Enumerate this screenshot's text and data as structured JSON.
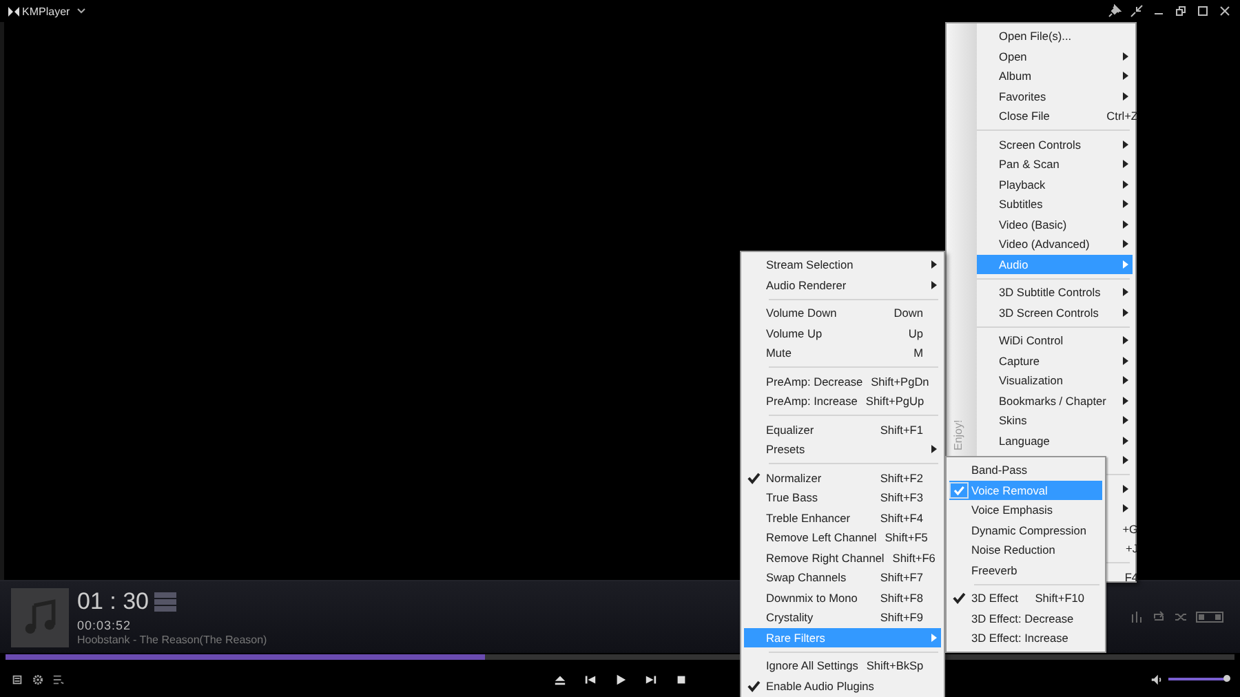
{
  "window": {
    "title": "KMPlayer"
  },
  "player": {
    "time": "01 : 30",
    "duration": "00:03:52",
    "track": "Hoobstank - The Reason(The Reason)",
    "progress": {
      "level": 0.39
    },
    "volume": {
      "level": 0.97
    }
  },
  "main_menu": {
    "side_text": "Enjoy!",
    "items": [
      {
        "kind": "item",
        "label": "Open File(s)...",
        "submenu": false,
        "selected": false
      },
      {
        "kind": "item",
        "label": "Open",
        "submenu": true,
        "selected": false
      },
      {
        "kind": "item",
        "label": "Album",
        "submenu": true,
        "selected": false
      },
      {
        "kind": "item",
        "label": "Favorites",
        "submenu": true,
        "selected": false
      },
      {
        "kind": "item",
        "label": "Close File",
        "shortcut": "Ctrl+Z",
        "submenu": false,
        "selected": false
      },
      {
        "kind": "separator"
      },
      {
        "kind": "item",
        "label": "Screen Controls",
        "submenu": true,
        "selected": false
      },
      {
        "kind": "item",
        "label": "Pan & Scan",
        "submenu": true,
        "selected": false
      },
      {
        "kind": "item",
        "label": "Playback",
        "submenu": true,
        "selected": false
      },
      {
        "kind": "item",
        "label": "Subtitles",
        "submenu": true,
        "selected": false
      },
      {
        "kind": "item",
        "label": "Video (Basic)",
        "submenu": true,
        "selected": false
      },
      {
        "kind": "item",
        "label": "Video (Advanced)",
        "submenu": true,
        "selected": false
      },
      {
        "kind": "item",
        "label": "Audio",
        "submenu": true,
        "selected": true
      },
      {
        "kind": "separator"
      },
      {
        "kind": "item",
        "label": "3D Subtitle Controls",
        "submenu": true,
        "selected": false
      },
      {
        "kind": "item",
        "label": "3D Screen Controls",
        "submenu": true,
        "selected": false
      },
      {
        "kind": "separator"
      },
      {
        "kind": "item",
        "label": "WiDi Control",
        "submenu": true,
        "selected": false
      },
      {
        "kind": "item",
        "label": "Capture",
        "submenu": true,
        "selected": false
      },
      {
        "kind": "item",
        "label": "Visualization",
        "submenu": true,
        "selected": false
      },
      {
        "kind": "item",
        "label": "Bookmarks / Chapter",
        "submenu": true,
        "selected": false
      },
      {
        "kind": "item",
        "label": "Skins",
        "submenu": true,
        "selected": false
      },
      {
        "kind": "item",
        "label": "Language",
        "submenu": true,
        "selected": false
      },
      {
        "kind": "item",
        "submenu": true,
        "selected": false
      },
      {
        "kind": "separator"
      },
      {
        "kind": "item",
        "submenu": true,
        "selected": false
      },
      {
        "kind": "item",
        "submenu": true,
        "selected": false
      },
      {
        "kind": "item",
        "shortcut": "+G",
        "submenu": false,
        "selected": false
      },
      {
        "kind": "item",
        "shortcut": "+J",
        "submenu": false,
        "selected": false
      },
      {
        "kind": "separator"
      },
      {
        "kind": "item",
        "shortcut": "F4",
        "submenu": false,
        "selected": false
      }
    ]
  },
  "audio_menu": {
    "items": [
      {
        "kind": "item",
        "label": "Stream Selection",
        "submenu": true,
        "checked": false,
        "selected": false
      },
      {
        "kind": "item",
        "label": "Audio Renderer",
        "submenu": true,
        "checked": false,
        "selected": false
      },
      {
        "kind": "separator"
      },
      {
        "kind": "item",
        "label": "Volume Down",
        "shortcut": "Down",
        "submenu": false,
        "checked": false,
        "selected": false
      },
      {
        "kind": "item",
        "label": "Volume Up",
        "shortcut": "Up",
        "submenu": false,
        "checked": false,
        "selected": false
      },
      {
        "kind": "item",
        "label": "Mute",
        "shortcut": "M",
        "submenu": false,
        "checked": false,
        "selected": false
      },
      {
        "kind": "separator"
      },
      {
        "kind": "item",
        "label": "PreAmp: Decrease",
        "shortcut": "Shift+PgDn",
        "submenu": false,
        "checked": false,
        "selected": false
      },
      {
        "kind": "item",
        "label": "PreAmp: Increase",
        "shortcut": "Shift+PgUp",
        "submenu": false,
        "checked": false,
        "selected": false
      },
      {
        "kind": "separator"
      },
      {
        "kind": "item",
        "label": "Equalizer",
        "shortcut": "Shift+F1",
        "submenu": false,
        "checked": false,
        "selected": false
      },
      {
        "kind": "item",
        "label": "Presets",
        "submenu": true,
        "checked": false,
        "selected": false
      },
      {
        "kind": "separator"
      },
      {
        "kind": "item",
        "label": "Normalizer",
        "shortcut": "Shift+F2",
        "submenu": false,
        "checked": true,
        "selected": false
      },
      {
        "kind": "item",
        "label": "True Bass",
        "shortcut": "Shift+F3",
        "submenu": false,
        "checked": false,
        "selected": false
      },
      {
        "kind": "item",
        "label": "Treble Enhancer",
        "shortcut": "Shift+F4",
        "submenu": false,
        "checked": false,
        "selected": false
      },
      {
        "kind": "item",
        "label": "Remove Left Channel",
        "shortcut": "Shift+F5",
        "submenu": false,
        "checked": false,
        "selected": false
      },
      {
        "kind": "item",
        "label": "Remove Right Channel",
        "shortcut": "Shift+F6",
        "submenu": false,
        "checked": false,
        "selected": false
      },
      {
        "kind": "item",
        "label": "Swap Channels",
        "shortcut": "Shift+F7",
        "submenu": false,
        "checked": false,
        "selected": false
      },
      {
        "kind": "item",
        "label": "Downmix to Mono",
        "shortcut": "Shift+F8",
        "submenu": false,
        "checked": false,
        "selected": false
      },
      {
        "kind": "item",
        "label": "Crystality",
        "shortcut": "Shift+F9",
        "submenu": false,
        "checked": false,
        "selected": false
      },
      {
        "kind": "item",
        "label": "Rare Filters",
        "submenu": true,
        "checked": false,
        "selected": true
      },
      {
        "kind": "separator"
      },
      {
        "kind": "item",
        "label": "Ignore All Settings",
        "shortcut": "Shift+BkSp",
        "submenu": false,
        "checked": false,
        "selected": false
      },
      {
        "kind": "item",
        "label": "Enable Audio Plugins",
        "submenu": false,
        "checked": true,
        "selected": false
      }
    ]
  },
  "rare_filters_menu": {
    "items": [
      {
        "kind": "item",
        "label": "Band-Pass",
        "submenu": false,
        "checked": false,
        "selected": false
      },
      {
        "kind": "item",
        "label": "Voice Removal",
        "submenu": false,
        "checked": true,
        "selected": true
      },
      {
        "kind": "item",
        "label": "Voice Emphasis",
        "submenu": false,
        "checked": false,
        "selected": false
      },
      {
        "kind": "item",
        "label": "Dynamic Compression",
        "submenu": false,
        "checked": false,
        "selected": false
      },
      {
        "kind": "item",
        "label": "Noise Reduction",
        "submenu": false,
        "checked": false,
        "selected": false
      },
      {
        "kind": "item",
        "label": "Freeverb",
        "submenu": false,
        "checked": false,
        "selected": false
      },
      {
        "kind": "separator"
      },
      {
        "kind": "item",
        "label": "3D Effect",
        "shortcut": "Shift+F10",
        "submenu": false,
        "checked": true,
        "selected": false
      },
      {
        "kind": "item",
        "label": "3D Effect: Decrease",
        "submenu": false,
        "checked": false,
        "selected": false
      },
      {
        "kind": "item",
        "label": "3D Effect: Increase",
        "submenu": false,
        "checked": false,
        "selected": false
      }
    ]
  }
}
